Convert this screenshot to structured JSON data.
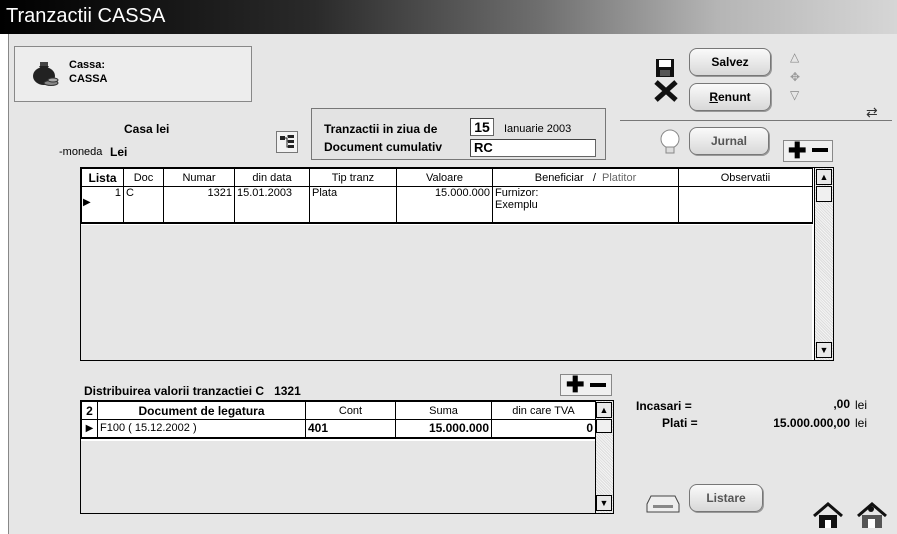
{
  "window": {
    "title": "Tranzactii CASSA"
  },
  "cassa": {
    "label": "Cassa:",
    "name": "CASSA"
  },
  "toolbar": {
    "save_label": "Salvez",
    "cancel_label": "Renunt",
    "cancel_hotkey": "R",
    "jurnal_label": "Jurnal",
    "listare_label": "Listare"
  },
  "casa": {
    "casa_label": "Casa lei",
    "moneda_label": "-moneda",
    "moneda_value": "Lei"
  },
  "day": {
    "label": "Tranzactii in ziua de",
    "day": "15",
    "month_year": "Ianuarie 2003",
    "doc_cumulativ_label": "Document cumulativ",
    "doc_cumulativ_value": "RC"
  },
  "main_table": {
    "columns": [
      "Lista",
      "Doc",
      "Numar",
      "din data",
      "Tip tranz",
      "Valoare",
      "Beneficiar",
      "/",
      "Platitor",
      "Observatii"
    ],
    "rows": [
      {
        "lista": "1",
        "doc": "C",
        "numar": "1321",
        "din_data": "15.01.2003",
        "tip": "Plata",
        "valoare": "15.000.000",
        "beneficiar_line1": "Furnizor:",
        "beneficiar_line2": "Exemplu",
        "observatii": ""
      }
    ]
  },
  "distrib": {
    "label": "Distribuirea valorii tranzactiei C",
    "doc_num": "1321",
    "columns": [
      "2",
      "Document de legatura",
      "Cont",
      "Suma",
      "din care TVA"
    ],
    "rows": [
      {
        "document": "F100 ( 15.12.2002 )",
        "cont": "401",
        "suma": "15.000.000",
        "tva": "0"
      }
    ]
  },
  "totals": {
    "incasari_label": "Incasari =",
    "incasari_value": ",00",
    "plati_label": "Plati =",
    "plati_value": "15.000.000,00",
    "currency": "lei"
  }
}
